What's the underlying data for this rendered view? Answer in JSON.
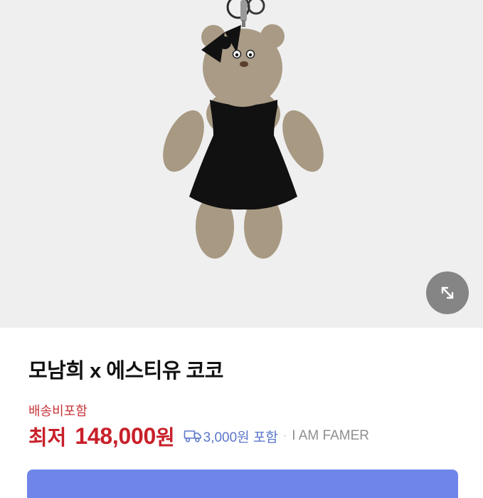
{
  "product_image": {
    "alt": "",
    "expand_icon": "expand-arrows-icon"
  },
  "product": {
    "title": "모남희 x 에스티유 코코",
    "shipping_label": "배송비포함",
    "price_prefix": "최저",
    "price_amount": "148,000",
    "price_unit": "원",
    "shipping_icon": "truck-icon",
    "shipping_fee": "3,000원 포함",
    "separator": "·",
    "seller": "I AM FAMER"
  },
  "colors": {
    "price_red": "#c8202a",
    "shipping_red": "#c8363b",
    "fee_blue": "#5a76c8",
    "button_blue": "#6f85ea",
    "hero_bg": "#efefef"
  }
}
